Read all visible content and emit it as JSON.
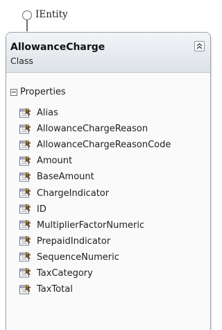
{
  "interface": {
    "name": "IEntity"
  },
  "class": {
    "name": "AllowanceCharge",
    "kind": "Class",
    "compartment_label": "Properties",
    "properties": [
      "Alias",
      "AllowanceChargeReason",
      "AllowanceChargeReasonCode",
      "Amount",
      "BaseAmount",
      "ChargeIndicator",
      "ID",
      "MultiplierFactorNumeric",
      "PrepaidIndicator",
      "SequenceNumeric",
      "TaxCategory",
      "TaxTotal"
    ]
  },
  "icons": {
    "interface": "lollipop-interface-icon",
    "collapse": "chevron-up-double-icon",
    "compartment_toggle": "collapse-minus-icon",
    "property": "property-icon"
  },
  "colors": {
    "border": "#9aa3ae",
    "header_top": "#f2f4f7",
    "header_bottom": "#dde2e8",
    "body": "#fafafa"
  }
}
